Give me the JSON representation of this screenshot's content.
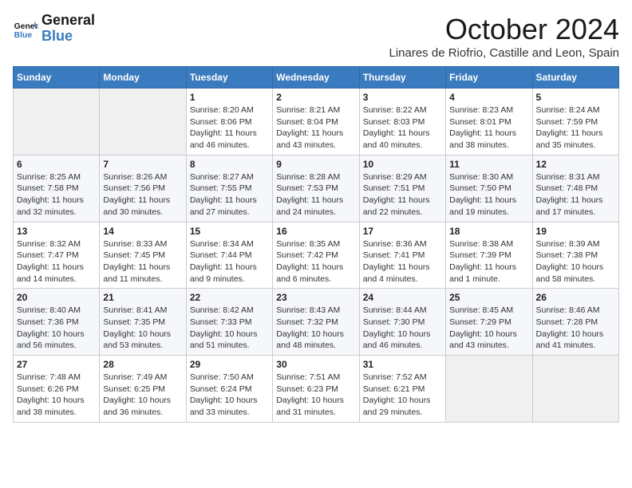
{
  "header": {
    "logo_line1": "General",
    "logo_line2": "Blue",
    "month_title": "October 2024",
    "location": "Linares de Riofrio, Castille and Leon, Spain"
  },
  "days_of_week": [
    "Sunday",
    "Monday",
    "Tuesday",
    "Wednesday",
    "Thursday",
    "Friday",
    "Saturday"
  ],
  "weeks": [
    [
      {
        "day": "",
        "sunrise": "",
        "sunset": "",
        "daylight": ""
      },
      {
        "day": "",
        "sunrise": "",
        "sunset": "",
        "daylight": ""
      },
      {
        "day": "1",
        "sunrise": "Sunrise: 8:20 AM",
        "sunset": "Sunset: 8:06 PM",
        "daylight": "Daylight: 11 hours and 46 minutes."
      },
      {
        "day": "2",
        "sunrise": "Sunrise: 8:21 AM",
        "sunset": "Sunset: 8:04 PM",
        "daylight": "Daylight: 11 hours and 43 minutes."
      },
      {
        "day": "3",
        "sunrise": "Sunrise: 8:22 AM",
        "sunset": "Sunset: 8:03 PM",
        "daylight": "Daylight: 11 hours and 40 minutes."
      },
      {
        "day": "4",
        "sunrise": "Sunrise: 8:23 AM",
        "sunset": "Sunset: 8:01 PM",
        "daylight": "Daylight: 11 hours and 38 minutes."
      },
      {
        "day": "5",
        "sunrise": "Sunrise: 8:24 AM",
        "sunset": "Sunset: 7:59 PM",
        "daylight": "Daylight: 11 hours and 35 minutes."
      }
    ],
    [
      {
        "day": "6",
        "sunrise": "Sunrise: 8:25 AM",
        "sunset": "Sunset: 7:58 PM",
        "daylight": "Daylight: 11 hours and 32 minutes."
      },
      {
        "day": "7",
        "sunrise": "Sunrise: 8:26 AM",
        "sunset": "Sunset: 7:56 PM",
        "daylight": "Daylight: 11 hours and 30 minutes."
      },
      {
        "day": "8",
        "sunrise": "Sunrise: 8:27 AM",
        "sunset": "Sunset: 7:55 PM",
        "daylight": "Daylight: 11 hours and 27 minutes."
      },
      {
        "day": "9",
        "sunrise": "Sunrise: 8:28 AM",
        "sunset": "Sunset: 7:53 PM",
        "daylight": "Daylight: 11 hours and 24 minutes."
      },
      {
        "day": "10",
        "sunrise": "Sunrise: 8:29 AM",
        "sunset": "Sunset: 7:51 PM",
        "daylight": "Daylight: 11 hours and 22 minutes."
      },
      {
        "day": "11",
        "sunrise": "Sunrise: 8:30 AM",
        "sunset": "Sunset: 7:50 PM",
        "daylight": "Daylight: 11 hours and 19 minutes."
      },
      {
        "day": "12",
        "sunrise": "Sunrise: 8:31 AM",
        "sunset": "Sunset: 7:48 PM",
        "daylight": "Daylight: 11 hours and 17 minutes."
      }
    ],
    [
      {
        "day": "13",
        "sunrise": "Sunrise: 8:32 AM",
        "sunset": "Sunset: 7:47 PM",
        "daylight": "Daylight: 11 hours and 14 minutes."
      },
      {
        "day": "14",
        "sunrise": "Sunrise: 8:33 AM",
        "sunset": "Sunset: 7:45 PM",
        "daylight": "Daylight: 11 hours and 11 minutes."
      },
      {
        "day": "15",
        "sunrise": "Sunrise: 8:34 AM",
        "sunset": "Sunset: 7:44 PM",
        "daylight": "Daylight: 11 hours and 9 minutes."
      },
      {
        "day": "16",
        "sunrise": "Sunrise: 8:35 AM",
        "sunset": "Sunset: 7:42 PM",
        "daylight": "Daylight: 11 hours and 6 minutes."
      },
      {
        "day": "17",
        "sunrise": "Sunrise: 8:36 AM",
        "sunset": "Sunset: 7:41 PM",
        "daylight": "Daylight: 11 hours and 4 minutes."
      },
      {
        "day": "18",
        "sunrise": "Sunrise: 8:38 AM",
        "sunset": "Sunset: 7:39 PM",
        "daylight": "Daylight: 11 hours and 1 minute."
      },
      {
        "day": "19",
        "sunrise": "Sunrise: 8:39 AM",
        "sunset": "Sunset: 7:38 PM",
        "daylight": "Daylight: 10 hours and 58 minutes."
      }
    ],
    [
      {
        "day": "20",
        "sunrise": "Sunrise: 8:40 AM",
        "sunset": "Sunset: 7:36 PM",
        "daylight": "Daylight: 10 hours and 56 minutes."
      },
      {
        "day": "21",
        "sunrise": "Sunrise: 8:41 AM",
        "sunset": "Sunset: 7:35 PM",
        "daylight": "Daylight: 10 hours and 53 minutes."
      },
      {
        "day": "22",
        "sunrise": "Sunrise: 8:42 AM",
        "sunset": "Sunset: 7:33 PM",
        "daylight": "Daylight: 10 hours and 51 minutes."
      },
      {
        "day": "23",
        "sunrise": "Sunrise: 8:43 AM",
        "sunset": "Sunset: 7:32 PM",
        "daylight": "Daylight: 10 hours and 48 minutes."
      },
      {
        "day": "24",
        "sunrise": "Sunrise: 8:44 AM",
        "sunset": "Sunset: 7:30 PM",
        "daylight": "Daylight: 10 hours and 46 minutes."
      },
      {
        "day": "25",
        "sunrise": "Sunrise: 8:45 AM",
        "sunset": "Sunset: 7:29 PM",
        "daylight": "Daylight: 10 hours and 43 minutes."
      },
      {
        "day": "26",
        "sunrise": "Sunrise: 8:46 AM",
        "sunset": "Sunset: 7:28 PM",
        "daylight": "Daylight: 10 hours and 41 minutes."
      }
    ],
    [
      {
        "day": "27",
        "sunrise": "Sunrise: 7:48 AM",
        "sunset": "Sunset: 6:26 PM",
        "daylight": "Daylight: 10 hours and 38 minutes."
      },
      {
        "day": "28",
        "sunrise": "Sunrise: 7:49 AM",
        "sunset": "Sunset: 6:25 PM",
        "daylight": "Daylight: 10 hours and 36 minutes."
      },
      {
        "day": "29",
        "sunrise": "Sunrise: 7:50 AM",
        "sunset": "Sunset: 6:24 PM",
        "daylight": "Daylight: 10 hours and 33 minutes."
      },
      {
        "day": "30",
        "sunrise": "Sunrise: 7:51 AM",
        "sunset": "Sunset: 6:23 PM",
        "daylight": "Daylight: 10 hours and 31 minutes."
      },
      {
        "day": "31",
        "sunrise": "Sunrise: 7:52 AM",
        "sunset": "Sunset: 6:21 PM",
        "daylight": "Daylight: 10 hours and 29 minutes."
      },
      {
        "day": "",
        "sunrise": "",
        "sunset": "",
        "daylight": ""
      },
      {
        "day": "",
        "sunrise": "",
        "sunset": "",
        "daylight": ""
      }
    ]
  ]
}
